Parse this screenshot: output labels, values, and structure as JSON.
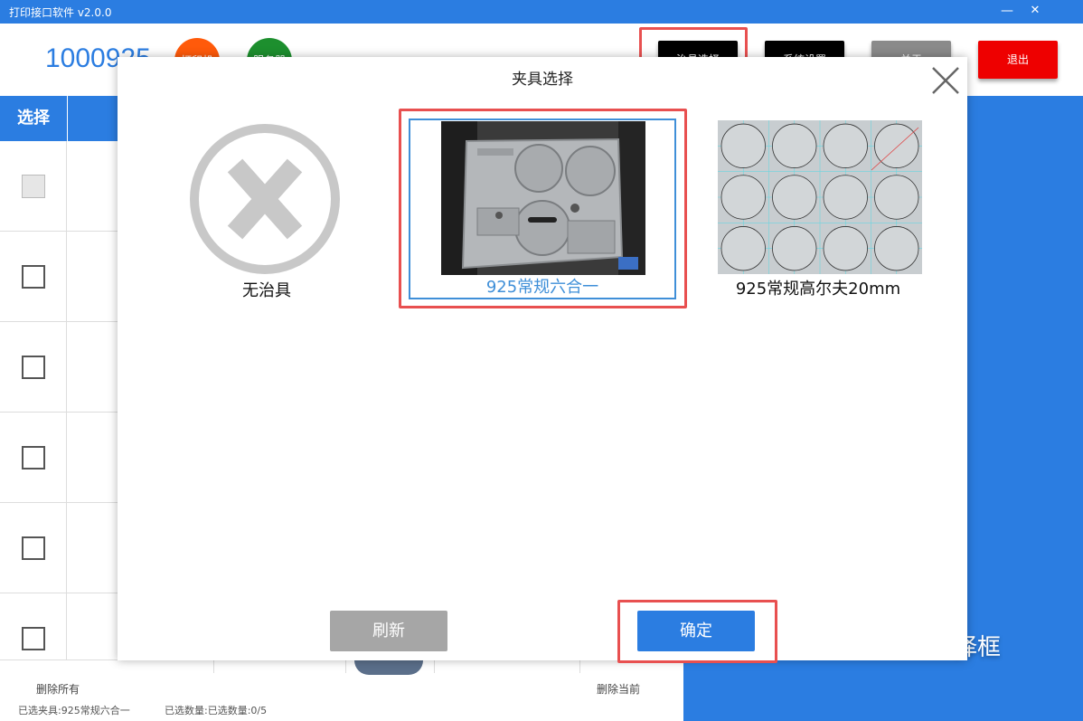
{
  "window": {
    "title": "打印接口软件 v2.0.0",
    "minimize_glyph": "—",
    "close_glyph": "✕"
  },
  "header": {
    "device_id": "1000925",
    "status_orange_label": "打印机",
    "status_green_label": "服务器",
    "buttons": [
      "治具选择",
      "系统设置",
      "关于",
      "退出"
    ]
  },
  "table": {
    "column_select": "选择",
    "rows": 6
  },
  "right_panel": {
    "text": "择框"
  },
  "footer": {
    "delete_all": "删除所有",
    "delete_current": "删除当前",
    "selected_fixture": "已选夹具:925常规六合一",
    "selected_count": "已选数量:已选数量:0/5"
  },
  "modal": {
    "title": "夹具选择",
    "fixtures": [
      {
        "label": "无治具",
        "icon": "no-fixture-icon"
      },
      {
        "label": "925常规六合一",
        "selected": true
      },
      {
        "label": "925常规高尔夫20mm"
      }
    ],
    "refresh_label": "刷新",
    "confirm_label": "确定"
  },
  "colors": {
    "primary": "#2b7de1",
    "danger": "#ee0000",
    "highlight": "#e85050",
    "orange": "#ff5a0a",
    "green": "#1d8f2e"
  }
}
